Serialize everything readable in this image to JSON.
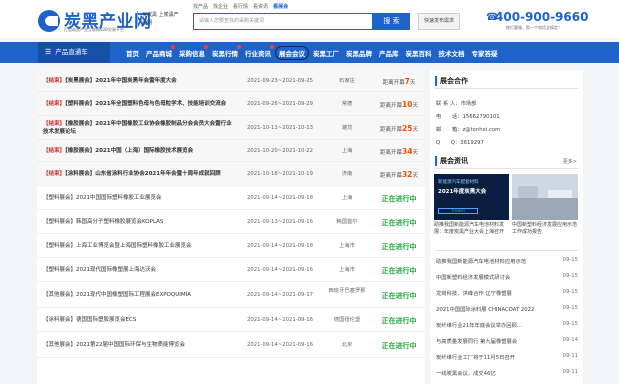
{
  "header": {
    "logo_name": "炭黑产业网",
    "logo_sub": "打造炭黑产业互联网B2B交易平台",
    "slogan": "买炭黑 上炭黑产业网",
    "search_tabs": [
      "找产品",
      "找企业",
      "看行情",
      "看资讯",
      "看展会"
    ],
    "search_placeholder": "请输入您要查找的采购关键词",
    "search_label": "搜 索",
    "publish_label": "快速发布需求",
    "phone": "400-900-9660",
    "phone_note": "拨打客服，即一个电话全搞定！"
  },
  "nav": {
    "category_label": "产品直通车",
    "items": [
      {
        "label": "首页"
      },
      {
        "label": "产品商城",
        "hot": true
      },
      {
        "label": "采购信息",
        "hot": true
      },
      {
        "label": "炭黑行情",
        "hot": true
      },
      {
        "label": "行业资讯",
        "hot": true
      },
      {
        "label": "展会会议",
        "highlighted": true
      },
      {
        "label": "炭黑工厂"
      },
      {
        "label": "炭黑品牌"
      },
      {
        "label": "产品库"
      },
      {
        "label": "炭黑百科"
      },
      {
        "label": "技术文档"
      },
      {
        "label": "专家答疑"
      }
    ]
  },
  "events": [
    {
      "tag": "【结束】",
      "title": "【炭黑展会】2021年中国炭黑年会暨年度大会",
      "date": "2021-09-23~2021-09-25",
      "city": "石家庄",
      "status_prefix": "距离开幕",
      "days": "7",
      "status_suffix": "天"
    },
    {
      "tag": "【结束】",
      "title": "【塑料展会】2021年全国塑料色母与色母粒学术、技能培训交流会",
      "date": "2021-09-26~2021-09-29",
      "city": "常德",
      "status_prefix": "距离开幕",
      "days": "10",
      "status_suffix": "天"
    },
    {
      "tag": "【结束】",
      "title": "【橡胶展会】2021年中国橡胶工业协会橡胶制品分会会员大会暨行业技术发展论坛",
      "date": "2021-10-11~2021-10-13",
      "city": "潍坊",
      "status_prefix": "距离开幕",
      "days": "25",
      "status_suffix": "天"
    },
    {
      "tag": "【结束】",
      "title": "【橡胶展会】2021中国（上海）国际橡胶技术展览会",
      "date": "2021-10-20~2021-10-22",
      "city": "上海",
      "status_prefix": "距离开幕",
      "days": "34",
      "status_suffix": "天"
    },
    {
      "tag": "【结束】",
      "title": "【涂料展会】山东省涂料行业协会2021年年会暨十周年成就回顾",
      "date": "2021-10-18~2021-10-19",
      "city": "济南",
      "status_prefix": "距离开幕",
      "days": "32",
      "status_suffix": "天"
    },
    {
      "title": "【塑料展会】2021中国国际塑料橡胶工业展览会",
      "date": "2021-09-14~2021-09-18",
      "city": "上海",
      "status": "正在进行中"
    },
    {
      "title": "【塑料展会】韩国高分子塑料橡胶展览会KOPLAS",
      "date": "2021-09-13~2021-09-16",
      "city": "韩国首尔",
      "status": "正在进行中"
    },
    {
      "title": "【塑料展会】上海工业博览会暨上海国际塑料橡胶工业展览会",
      "date": "2021-09-14~2021-09-18",
      "city": "上海市",
      "status": "正在进行中"
    },
    {
      "title": "【塑料展会】2021现代国际橡塑展上海达沃会",
      "date": "2021-09-14~2021-09-16",
      "city": "上海市",
      "status": "正在进行中"
    },
    {
      "title": "【其他展会】2021现代中国橡塑国际工程展会EXPOQUIMIA",
      "date": "2021-09-14~2021-09-17",
      "city": "西班牙巴塞罗那",
      "status": "正在进行中"
    },
    {
      "title": "【涂料展会】德国国际塑胶展览会ECS",
      "date": "2021-09-14~2021-09-16",
      "city": "德国纽伦堡",
      "status": "正在进行中"
    },
    {
      "title": "【其他展会】2021第22届中国国际环保与生物质能博览会",
      "date": "2021-09-14~2021-09-16",
      "city": "北京",
      "status": "正在进行中"
    }
  ],
  "sidebar": {
    "cooperation_title": "展会合作",
    "contact_label": "联 系 人：",
    "contact_name": "市场部",
    "phone_label": "电　　话：",
    "phone": "15662790101",
    "email_label": "邮　　箱：",
    "email": "z@tonhei.com",
    "qq_label": "Q　　Q：",
    "qq": "3619297",
    "news_title": "展会资讯",
    "more_label": "更多>",
    "ad_line1": "新能源汽车配套材料",
    "ad_line2": "2021年度炭黑大会",
    "ad_logo": "TONHEI",
    "ad_caption_1": "助推我国新能源汽车电池材料发展：年度炭黑产业大会上海召开",
    "ad_caption_2": "中国新塑料经济发展应用示范工作成功报告",
    "news": [
      {
        "title": "助推我国新能源汽车电池材料应用示范",
        "date": "09-15"
      },
      {
        "title": "中国新塑料经济发展模式研讨会",
        "date": "09-15"
      },
      {
        "title": "龙岗科技、洪峰合作 辽宁橡塑展",
        "date": "09-15"
      },
      {
        "title": "2021中国国际涂料展 CHINACOAT 2022",
        "date": "09-15"
      },
      {
        "title": "炭纤维行业21年年底会议举办回顾...",
        "date": "09-15"
      },
      {
        "title": "与高质量发展同行 第九届橡塑展会",
        "date": "09-14"
      },
      {
        "title": "炭纤维行业工厂将于11月5日召开",
        "date": "09-11"
      },
      {
        "title": "一线炭黑会议，成交46亿",
        "date": "09-11"
      }
    ]
  }
}
